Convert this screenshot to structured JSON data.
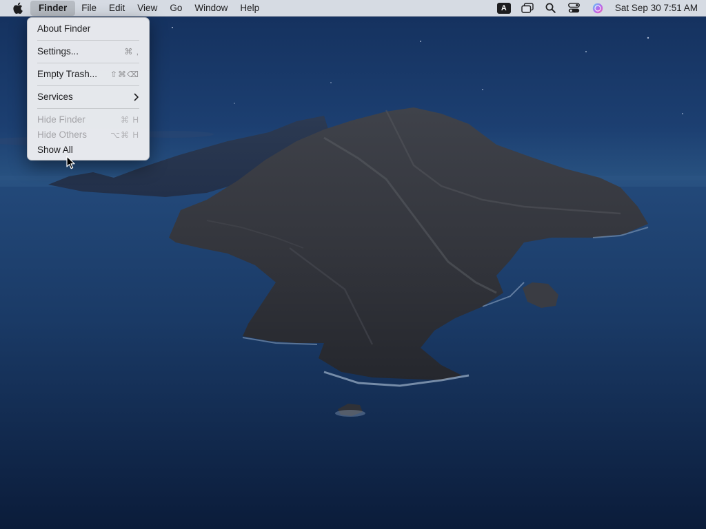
{
  "menubar": {
    "apple_icon": "apple-logo-icon",
    "app_name": "Finder",
    "menus": [
      "File",
      "Edit",
      "View",
      "Go",
      "Window",
      "Help"
    ],
    "status": {
      "input_source": "A",
      "icons": [
        "window-stack-icon",
        "search-icon",
        "control-center-icon",
        "siri-icon"
      ],
      "clock": "Sat Sep 30  7:51 AM"
    }
  },
  "dropdown": {
    "items": [
      {
        "label": "About Finder",
        "shortcut": "",
        "enabled": true
      },
      {
        "label": "Settings...",
        "shortcut": "⌘ ,",
        "enabled": true
      },
      {
        "label": "Empty Trash...",
        "shortcut": "⇧⌘⌫",
        "enabled": true
      },
      {
        "label": "Services",
        "shortcut": "",
        "submenu": true,
        "enabled": true
      },
      {
        "label": "Hide Finder",
        "shortcut": "⌘ H",
        "enabled": false
      },
      {
        "label": "Hide Others",
        "shortcut": "⌥⌘ H",
        "enabled": false
      },
      {
        "label": "Show All",
        "shortcut": "",
        "enabled": true
      }
    ]
  },
  "colors": {
    "menubar_bg": "#e2e5ec",
    "menu_text": "#1d1d1f",
    "disabled_text": "#a4a4a8",
    "wallpaper_sea": "#1b3a68",
    "wallpaper_island": "#3b3d45"
  }
}
